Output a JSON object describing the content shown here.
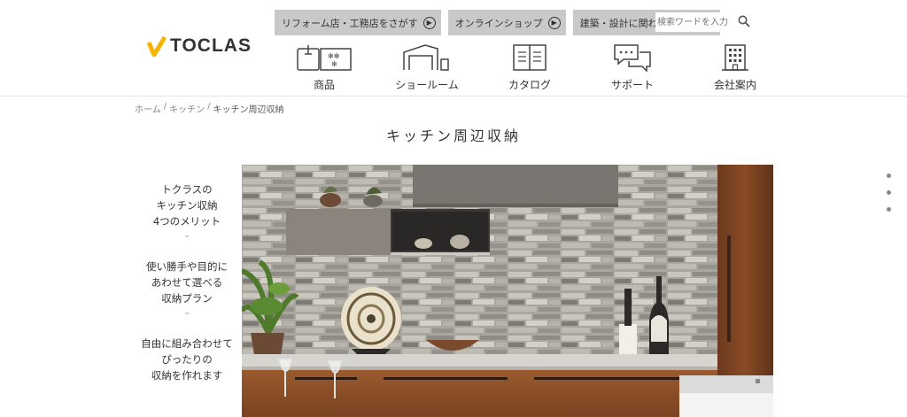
{
  "logo": {
    "text": "TOCLAS"
  },
  "top_links": [
    {
      "label": "リフォーム店・工務店をさがす"
    },
    {
      "label": "オンラインショップ"
    },
    {
      "label": "建築・設計に関わる方向け"
    }
  ],
  "search": {
    "placeholder": "検索ワードを入力"
  },
  "nav": [
    {
      "label": "商品",
      "icon": "products-icon"
    },
    {
      "label": "ショールーム",
      "icon": "showroom-icon"
    },
    {
      "label": "カタログ",
      "icon": "catalog-icon"
    },
    {
      "label": "サポート",
      "icon": "support-icon"
    },
    {
      "label": "会社案内",
      "icon": "company-icon"
    }
  ],
  "breadcrumb": {
    "home": "ホーム",
    "sep": "/",
    "kitchen": "キッチン",
    "current": "キッチン周辺収納"
  },
  "page_title": "キッチン周辺収納",
  "side_menu": [
    {
      "line1": "トクラスの",
      "line2": "キッチン収納",
      "line3": "4つのメリット"
    },
    {
      "line1": "使い勝手や目的に",
      "line2": "あわせて選べる",
      "line3": "収納プラン"
    },
    {
      "line1": "自由に組み合わせて",
      "line2": "ぴったりの",
      "line3": "収納を作れます"
    }
  ],
  "chevron": "⌄",
  "colors": {
    "accent": "#f5b400",
    "topLinkBg": "#c9c9c9",
    "text": "#333333"
  }
}
